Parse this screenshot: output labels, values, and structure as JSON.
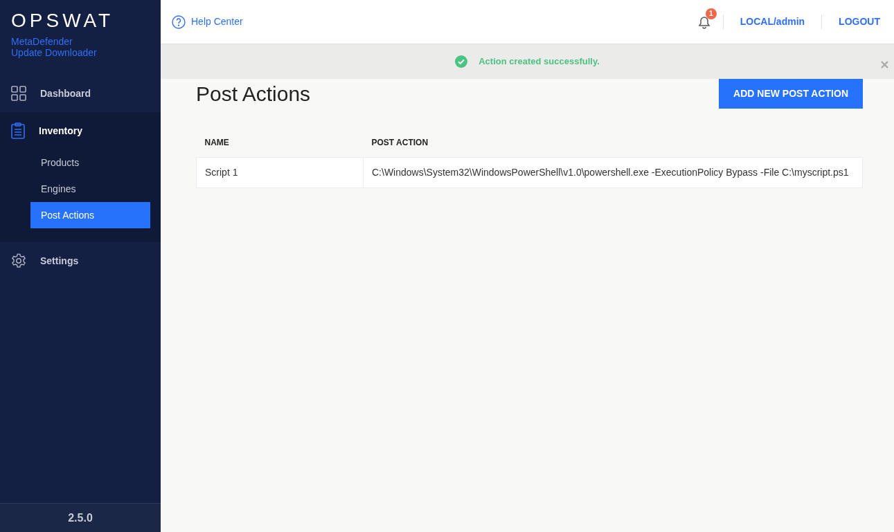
{
  "sidebar": {
    "logo": "OPSWAT",
    "product": "MetaDefender",
    "subtitle": "Update Downloader",
    "items": [
      {
        "label": "Dashboard",
        "expanded": false
      },
      {
        "label": "Inventory",
        "expanded": true,
        "children": [
          {
            "label": "Products",
            "selected": false
          },
          {
            "label": "Engines",
            "selected": false
          },
          {
            "label": "Post Actions",
            "selected": true
          }
        ]
      },
      {
        "label": "Settings",
        "expanded": false
      }
    ],
    "version": "2.5.0"
  },
  "header": {
    "help": "Help Center",
    "notifications": "1",
    "user": "LOCAL/admin",
    "logout": "LOGOUT"
  },
  "alert": {
    "message": "Action created successfully."
  },
  "page": {
    "title": "Post Actions",
    "button": "ADD NEW POST ACTION"
  },
  "table": {
    "columns": [
      "NAME",
      "POST ACTION"
    ],
    "rows": [
      [
        "Script 1",
        "C:\\Windows\\System32\\WindowsPowerShell\\v1.0\\powershell.exe -ExecutionPolicy Bypass -File C:\\myscript.ps1"
      ]
    ]
  }
}
